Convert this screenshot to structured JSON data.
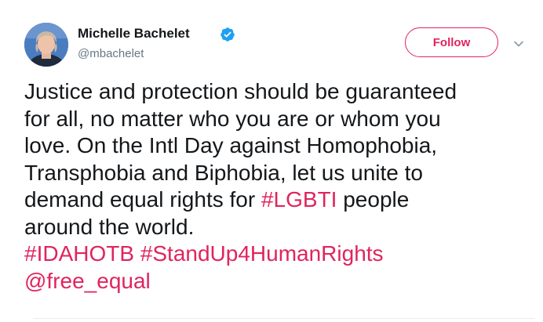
{
  "author": {
    "display_name": "Michelle Bachelet",
    "handle": "@mbachelet",
    "verified": true
  },
  "follow_button": {
    "label": "Follow"
  },
  "menu": {
    "icon": "chevron-down-icon"
  },
  "tweet": {
    "lines": [
      {
        "text": "Justice and protection should be guaranteed"
      },
      {
        "text": "for all, no matter who you are or whom you"
      },
      {
        "text": "love. On the Intl Day against Homophobia,"
      },
      {
        "text": "Transphobia and Biphobia, let us unite to"
      },
      {
        "before": "demand equal rights for ",
        "hashtag": "#LGBTI",
        "after": " people"
      },
      {
        "text": "around the world."
      }
    ],
    "hashtags": [
      "#IDAHOTB",
      "#StandUp4HumanRights"
    ],
    "mention": "@free_equal"
  },
  "colors": {
    "accent": "#e0245e",
    "text": "#14171a",
    "secondary_text": "#657786",
    "verified_badge": "#1da1f2",
    "divider": "#e6ecf0"
  }
}
